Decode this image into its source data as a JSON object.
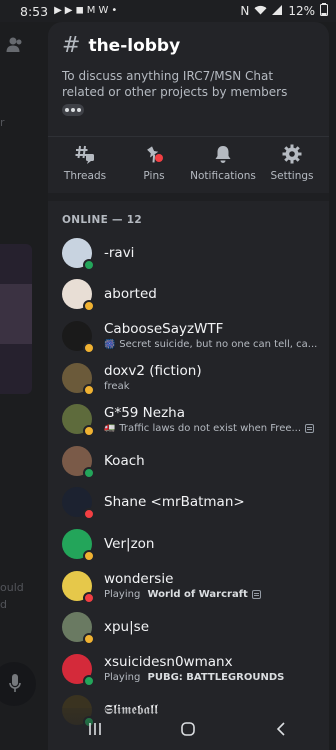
{
  "status_bar": {
    "time": "8:53",
    "battery": "12%",
    "dot": "•"
  },
  "background": {
    "frag_r": "r",
    "frag_ould": "ould",
    "frag_d": "d"
  },
  "channel": {
    "hash": "#",
    "name": "the-lobby",
    "topic": "To discuss anything IRC7/MSN Chat related or other projects by members"
  },
  "actions": [
    {
      "label": "Threads",
      "icon": "threads-icon"
    },
    {
      "label": "Pins",
      "icon": "pin-icon"
    },
    {
      "label": "Notifications",
      "icon": "bell-icon"
    },
    {
      "label": "Settings",
      "icon": "gear-icon"
    }
  ],
  "members_section": "ONLINE — 12",
  "members": [
    {
      "name": "-ravi",
      "sub": "",
      "status": "online",
      "avatar_color": "#c8d3e0"
    },
    {
      "name": "aborted",
      "sub": "",
      "status": "idle",
      "avatar_color": "#e8ded5"
    },
    {
      "name": "CabooseSayzWTF",
      "sub_prefix": "🎆",
      "sub": "Secret suicide, but no one can tell, ca...",
      "status": "idle",
      "avatar_color": "#1a1a1a"
    },
    {
      "name": "doxv2 (fiction)",
      "sub": "freak",
      "status": "idle",
      "avatar_color": "#6b5a3a"
    },
    {
      "name": "G*59 Nezha",
      "sub_prefix": "🚛",
      "sub": "Traffic laws do not exist when Free...",
      "status": "idle",
      "avatar_color": "#5e6b3c"
    },
    {
      "name": "Koach",
      "sub": "",
      "status": "online",
      "avatar_color": "#7a5a48"
    },
    {
      "name": "Shane <mrBatman>",
      "sub": "",
      "status": "dnd",
      "avatar_color": "#1c2230"
    },
    {
      "name": "Ver|zon",
      "sub": "",
      "status": "idle",
      "avatar_color": "#23a55a"
    },
    {
      "name": "wondersie",
      "sub_prefix": "Playing ",
      "sub_bold": "World of Warcraft",
      "status": "dnd",
      "avatar_color": "#e6c84a"
    },
    {
      "name": "xpu|se",
      "sub": "",
      "status": "idle",
      "avatar_color": "#6a7a62"
    },
    {
      "name": "xsuicidesn0wmanx",
      "sub_prefix": "Playing ",
      "sub_bold": "PUBG: BATTLEGROUNDS",
      "status": "online",
      "avatar_color": "#d42a3a"
    },
    {
      "name": "𝕾𝖑𝖎𝖒𝖊𝖇𝖆𝖑𝖑",
      "sub": "",
      "status": "online",
      "avatar_color": "#3a3320"
    }
  ],
  "colors": {
    "online": "#23a55a",
    "idle": "#f0b232",
    "dnd": "#f23f43",
    "panel_bg": "#232428",
    "pin_dot": "#f23f43"
  }
}
